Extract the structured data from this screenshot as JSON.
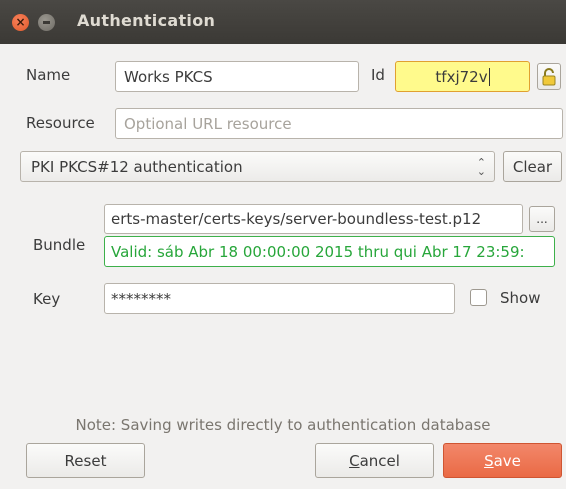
{
  "window": {
    "title": "Authentication"
  },
  "form": {
    "name_label": "Name",
    "name_value": "Works PKCS",
    "id_label": "Id",
    "id_value": "tfxj72v",
    "resource_label": "Resource",
    "resource_placeholder": "Optional URL resource",
    "method_selected": "PKI PKCS#12 authentication",
    "clear_label": "Clear",
    "bundle_label": "Bundle",
    "bundle_path": "erts-master/certs-keys/server-boundless-test.p12",
    "browse_label": "...",
    "validity_text": "Valid: sáb Abr 18 00:00:00 2015 thru qui Abr 17 23:59:",
    "key_label": "Key",
    "key_value": "********",
    "show_label": "Show"
  },
  "footer": {
    "note": "Note: Saving writes directly to authentication database",
    "reset_label": "Reset",
    "cancel_label": "Cancel",
    "save_label": "Save"
  },
  "colors": {
    "titlebar": "#3b3935",
    "id_field_bg": "#fffa8c",
    "validity_green": "#27a63a",
    "save_accent": "#ea6a45"
  }
}
